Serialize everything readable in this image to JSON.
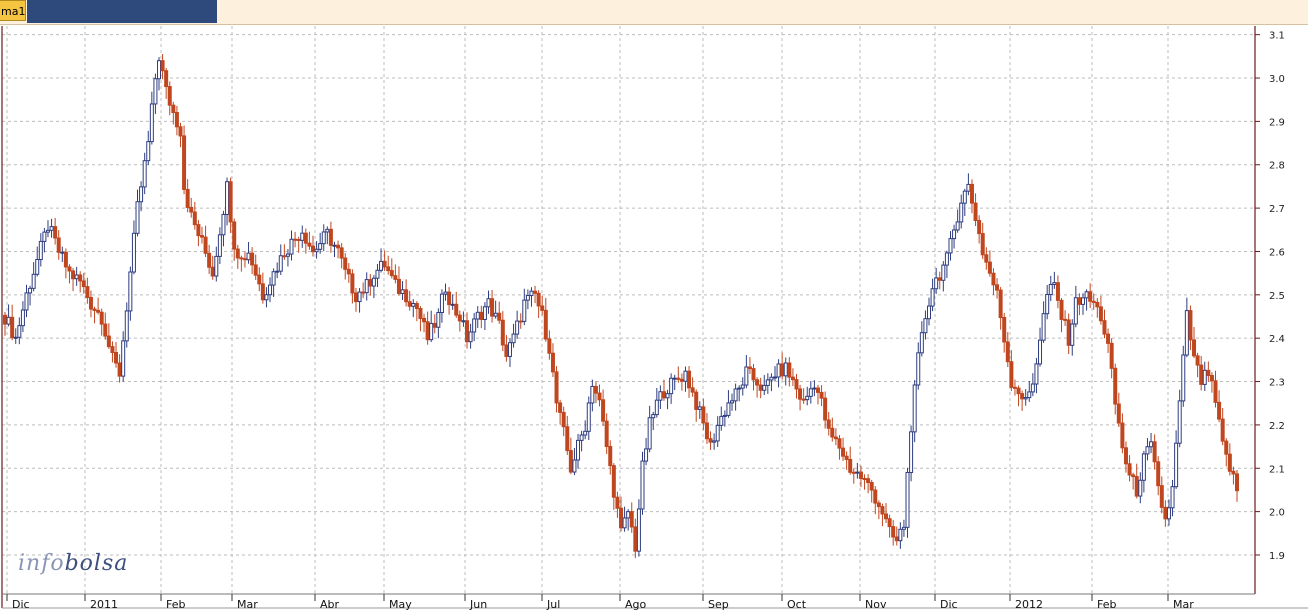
{
  "tab": {
    "label": "ma1",
    "accent": "#2e4a7d"
  },
  "watermark": {
    "part1": "info",
    "part2": "bolsa"
  },
  "colors": {
    "up": "#2e3d80",
    "down": "#c0461f",
    "grid": "#bdbdbd",
    "axis": "#6b1a1a"
  },
  "chart_data": {
    "type": "candlestick",
    "title": "",
    "xlabel": "",
    "ylabel": "",
    "ylim": [
      1.81,
      3.12
    ],
    "yticks": [
      1.9,
      2.0,
      2.1,
      2.2,
      2.3,
      2.4,
      2.5,
      2.6,
      2.7,
      2.8,
      2.9,
      3.0,
      3.1
    ],
    "grid": true,
    "x_labels": [
      "Dic",
      "2011",
      "Feb",
      "Mar",
      "Abr",
      "May",
      "Jun",
      "Jul",
      "Ago",
      "Sep",
      "Oct",
      "Nov",
      "Dic",
      "2012",
      "Feb",
      "Mar"
    ],
    "series": [
      {
        "close_path": [
          [
            0,
            2.45
          ],
          [
            3,
            2.4
          ],
          [
            6,
            2.5
          ],
          [
            9,
            2.58
          ],
          [
            12,
            2.66
          ],
          [
            15,
            2.6
          ],
          [
            18,
            2.55
          ],
          [
            21,
            2.53
          ],
          [
            24,
            2.48
          ],
          [
            27,
            2.45
          ],
          [
            30,
            2.35
          ],
          [
            32,
            2.32
          ],
          [
            35,
            2.55
          ],
          [
            37,
            2.7
          ],
          [
            40,
            2.85
          ],
          [
            42,
            3.0
          ],
          [
            43,
            3.05
          ],
          [
            45,
            2.97
          ],
          [
            47,
            2.92
          ],
          [
            49,
            2.88
          ],
          [
            50,
            2.75
          ],
          [
            52,
            2.68
          ],
          [
            55,
            2.62
          ],
          [
            58,
            2.55
          ],
          [
            60,
            2.65
          ],
          [
            62,
            2.75
          ],
          [
            64,
            2.62
          ],
          [
            66,
            2.58
          ],
          [
            68,
            2.6
          ],
          [
            70,
            2.55
          ],
          [
            72,
            2.5
          ],
          [
            75,
            2.55
          ],
          [
            78,
            2.6
          ],
          [
            80,
            2.62
          ],
          [
            83,
            2.65
          ],
          [
            86,
            2.6
          ],
          [
            88,
            2.62
          ],
          [
            90,
            2.64
          ],
          [
            93,
            2.6
          ],
          [
            95,
            2.55
          ],
          [
            98,
            2.5
          ],
          [
            101,
            2.52
          ],
          [
            103,
            2.55
          ],
          [
            106,
            2.57
          ],
          [
            109,
            2.52
          ],
          [
            112,
            2.5
          ],
          [
            115,
            2.47
          ],
          [
            118,
            2.4
          ],
          [
            121,
            2.45
          ],
          [
            123,
            2.52
          ],
          [
            125,
            2.47
          ],
          [
            127,
            2.45
          ],
          [
            129,
            2.4
          ],
          [
            132,
            2.45
          ],
          [
            135,
            2.48
          ],
          [
            138,
            2.43
          ],
          [
            140,
            2.36
          ],
          [
            142,
            2.4
          ],
          [
            145,
            2.48
          ],
          [
            148,
            2.5
          ],
          [
            150,
            2.45
          ],
          [
            152,
            2.38
          ],
          [
            154,
            2.25
          ],
          [
            156,
            2.18
          ],
          [
            158,
            2.1
          ],
          [
            160,
            2.15
          ],
          [
            162,
            2.2
          ],
          [
            164,
            2.3
          ],
          [
            166,
            2.25
          ],
          [
            168,
            2.15
          ],
          [
            170,
            2.05
          ],
          [
            172,
            1.95
          ],
          [
            174,
            2.0
          ],
          [
            176,
            1.92
          ],
          [
            178,
            2.1
          ],
          [
            180,
            2.2
          ],
          [
            182,
            2.25
          ],
          [
            184,
            2.28
          ],
          [
            187,
            2.3
          ],
          [
            190,
            2.32
          ],
          [
            193,
            2.25
          ],
          [
            195,
            2.2
          ],
          [
            197,
            2.15
          ],
          [
            199,
            2.2
          ],
          [
            202,
            2.25
          ],
          [
            205,
            2.28
          ],
          [
            207,
            2.32
          ],
          [
            210,
            2.3
          ],
          [
            212,
            2.28
          ],
          [
            215,
            2.32
          ],
          [
            218,
            2.33
          ],
          [
            220,
            2.3
          ],
          [
            223,
            2.25
          ],
          [
            226,
            2.3
          ],
          [
            228,
            2.25
          ],
          [
            230,
            2.18
          ],
          [
            233,
            2.15
          ],
          [
            236,
            2.1
          ],
          [
            239,
            2.08
          ],
          [
            242,
            2.05
          ],
          [
            245,
            2.0
          ],
          [
            247,
            1.95
          ],
          [
            249,
            1.93
          ],
          [
            251,
            1.97
          ],
          [
            253,
            2.2
          ],
          [
            255,
            2.35
          ],
          [
            257,
            2.45
          ],
          [
            259,
            2.52
          ],
          [
            261,
            2.55
          ],
          [
            263,
            2.58
          ],
          [
            265,
            2.65
          ],
          [
            267,
            2.72
          ],
          [
            269,
            2.75
          ],
          [
            271,
            2.68
          ],
          [
            273,
            2.6
          ],
          [
            275,
            2.55
          ],
          [
            277,
            2.5
          ],
          [
            279,
            2.4
          ],
          [
            281,
            2.3
          ],
          [
            283,
            2.28
          ],
          [
            285,
            2.25
          ],
          [
            287,
            2.3
          ],
          [
            289,
            2.4
          ],
          [
            291,
            2.5
          ],
          [
            293,
            2.52
          ],
          [
            295,
            2.45
          ],
          [
            297,
            2.4
          ],
          [
            299,
            2.48
          ],
          [
            301,
            2.5
          ],
          [
            304,
            2.48
          ],
          [
            306,
            2.45
          ],
          [
            308,
            2.38
          ],
          [
            310,
            2.25
          ],
          [
            312,
            2.15
          ],
          [
            314,
            2.08
          ],
          [
            316,
            2.05
          ],
          [
            318,
            2.12
          ],
          [
            320,
            2.15
          ],
          [
            322,
            2.05
          ],
          [
            324,
            1.98
          ],
          [
            326,
            2.05
          ],
          [
            328,
            2.25
          ],
          [
            330,
            2.45
          ],
          [
            332,
            2.35
          ],
          [
            334,
            2.3
          ],
          [
            336,
            2.32
          ],
          [
            338,
            2.25
          ],
          [
            340,
            2.15
          ],
          [
            342,
            2.1
          ],
          [
            344,
            2.05
          ]
        ]
      }
    ]
  }
}
